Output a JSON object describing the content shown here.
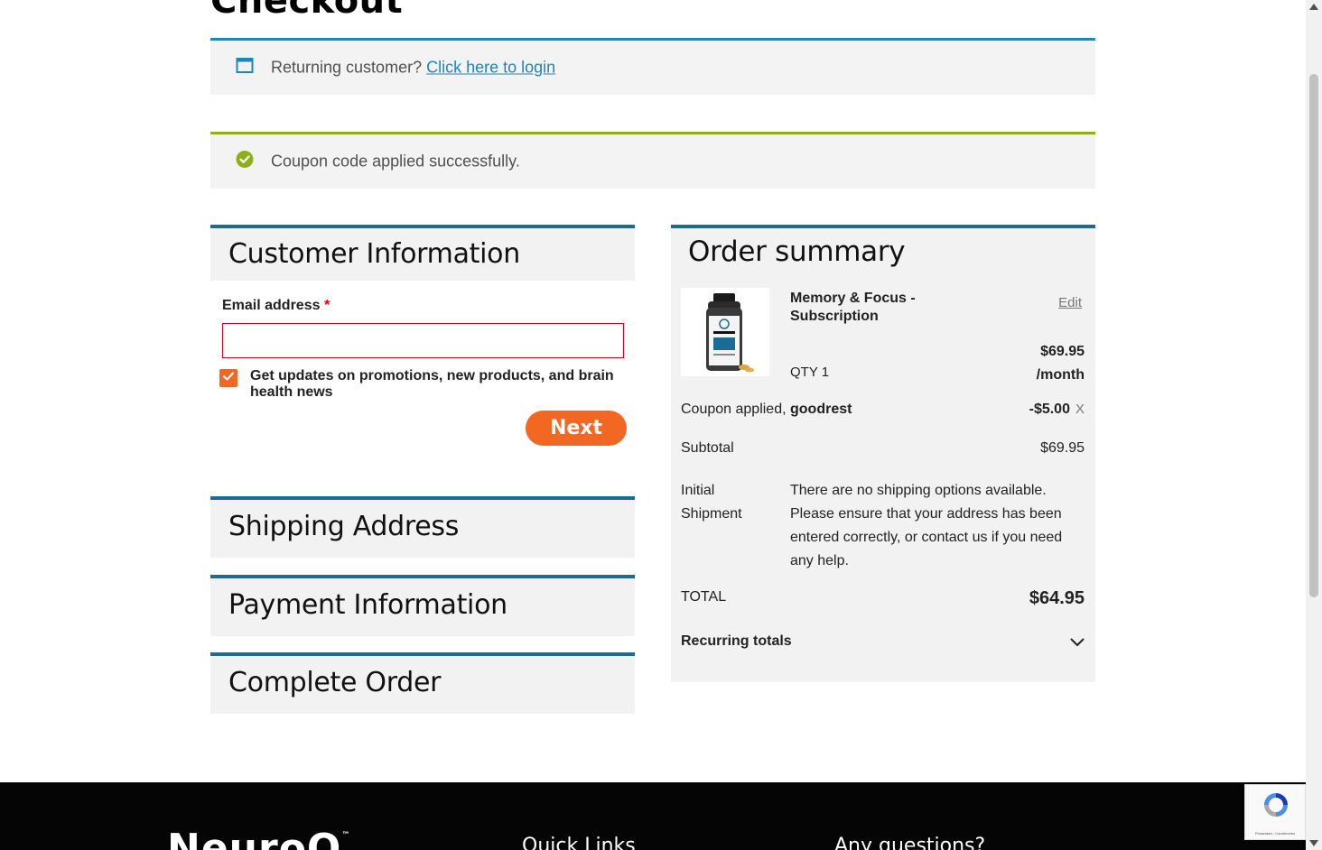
{
  "page": {
    "title": "Checkout"
  },
  "notices": {
    "returning_text": "Returning customer?",
    "login_link": "Click here to login",
    "coupon_success": "Coupon code applied successfully."
  },
  "customer": {
    "heading": "Customer Information",
    "email_label": "Email address",
    "required_mark": "*",
    "email_value": "",
    "updates_label": "Get updates on promotions, new products, and brain health news",
    "updates_checked": true,
    "next_label": "Next"
  },
  "sections": {
    "shipping": "Shipping Address",
    "payment": "Payment Information",
    "complete": "Complete Order"
  },
  "summary": {
    "heading": "Order summary",
    "product_name": "Memory & Focus - Subscription",
    "edit_label": "Edit",
    "qty": "QTY 1",
    "price": "$69.95",
    "price_period": "/month",
    "coupon_label": "Coupon applied,",
    "coupon_code": "goodrest",
    "coupon_amount": "-$5.00",
    "coupon_remove": "X",
    "subtotal_label": "Subtotal",
    "subtotal_value": "$69.95",
    "shipping_label": "Initial Shipment",
    "shipping_message": "There are no shipping options available. Please ensure that your address has been entered correctly, or contact us if you need any help.",
    "total_label": "TOTAL",
    "total_value": "$64.95",
    "recurring_label": "Recurring totals"
  },
  "footer": {
    "logo": "NeuroQ",
    "logo_mark": "™",
    "quick_links": "Quick Links",
    "questions": "Any questions?"
  },
  "recaptcha": {
    "text": "Privacidad - Condiciones"
  },
  "colors": {
    "accent_orange": "#f26722",
    "section_border": "#1b6c94",
    "info_border": "#1e85be",
    "success_border": "#8fae1b",
    "error_border": "#d0021b"
  },
  "icons": [
    "window-icon",
    "check-circle-icon",
    "checkmark-icon",
    "chevron-down-icon",
    "recaptcha-icon"
  ]
}
